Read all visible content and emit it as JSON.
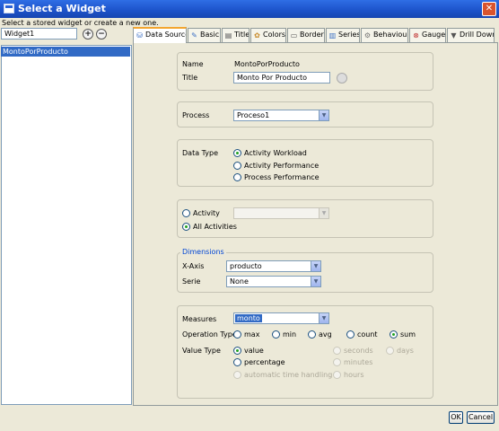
{
  "window": {
    "title": "Select a Widget",
    "close_glyph": "✕"
  },
  "subtitle": "Select a stored widget or create a new one.",
  "widget_name_value": "Widget1",
  "widget_list": [
    "MontoPorProducto"
  ],
  "tabs": [
    {
      "label": "Data Source",
      "icon": "data-source-icon"
    },
    {
      "label": "Basic",
      "icon": "basic-icon"
    },
    {
      "label": "Title",
      "icon": "title-icon"
    },
    {
      "label": "Colors",
      "icon": "colors-icon"
    },
    {
      "label": "Border",
      "icon": "border-icon"
    },
    {
      "label": "Series",
      "icon": "series-icon"
    },
    {
      "label": "Behaviour",
      "icon": "behaviour-icon"
    },
    {
      "label": "Gauge",
      "icon": "gauge-icon"
    },
    {
      "label": "Drill Down",
      "icon": "drill-down-icon"
    }
  ],
  "name_group": {
    "name_label": "Name",
    "name_value": "MontoPorProducto",
    "title_label": "Title",
    "title_value": "Monto Por Producto"
  },
  "process_group": {
    "label": "Process",
    "value": "Proceso1"
  },
  "data_type_group": {
    "label": "Data Type",
    "options": [
      "Activity Workload",
      "Activity Performance",
      "Process Performance"
    ],
    "selected": "Activity Workload"
  },
  "activity_group": {
    "activity_label": "Activity",
    "all_label": "All Activities",
    "selected": "All Activities",
    "activity_value": ""
  },
  "dimensions_group": {
    "title": "Dimensions",
    "x_axis_label": "X-Axis",
    "x_axis_value": "producto",
    "serie_label": "Serie",
    "serie_value": "None"
  },
  "measures_group": {
    "measures_label": "Measures",
    "measures_value": "monto",
    "operation_label": "Operation Type",
    "operations": [
      "max",
      "min",
      "avg",
      "count",
      "sum"
    ],
    "operation_selected": "sum",
    "value_label": "Value Type",
    "value_types": [
      "value",
      "percentage",
      "automatic time handling"
    ],
    "value_selected": "value",
    "time_units": [
      "seconds",
      "minutes",
      "hours",
      "days"
    ]
  },
  "buttons": {
    "ok": "OK",
    "cancel": "Cancel"
  },
  "colors": {
    "accent": "#316ac5",
    "title_bar": "#1c52c9",
    "group_title": "#0046d5",
    "radio_on": "#21a121"
  }
}
